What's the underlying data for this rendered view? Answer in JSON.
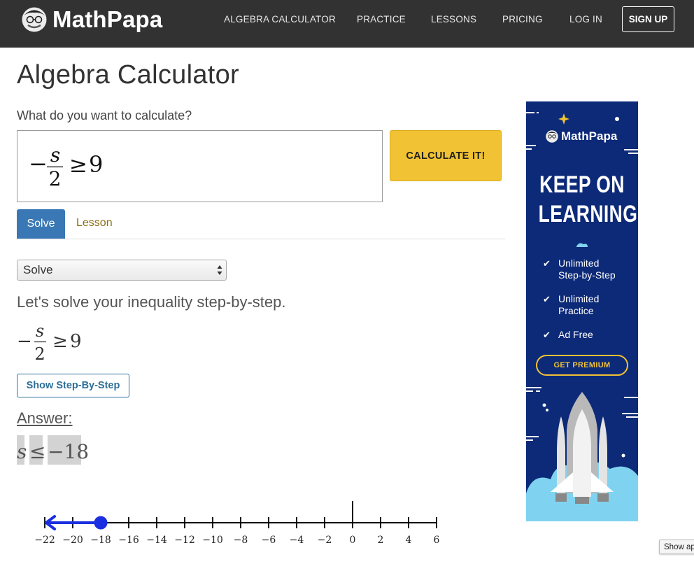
{
  "header": {
    "brand": "MathPapa",
    "nav": [
      "ALGEBRA CALCULATOR",
      "PRACTICE",
      "LESSONS",
      "PRICING",
      "LOG IN"
    ],
    "signup_label": "SIGN UP"
  },
  "page_title": "Algebra Calculator",
  "prompt": "What do you want to calculate?",
  "input": {
    "minus": "−",
    "numerator": "s",
    "denominator": "2",
    "relation": "≥",
    "rhs": "9"
  },
  "calculate_label": "CALCULATE IT!",
  "tabs": {
    "solve": "Solve",
    "lesson": "Lesson"
  },
  "select": {
    "selected": "Solve"
  },
  "intro": "Let's solve your inequality step-by-step.",
  "step_button": "Show Step-By-Step",
  "answer": {
    "label": "Answer:",
    "variable": "s",
    "relation": "≤",
    "value": "−18"
  },
  "number_line": {
    "tick_labels": [
      "−22",
      "−20",
      "−18",
      "−16",
      "−14",
      "−12",
      "−10",
      "−8",
      "−6",
      "−4",
      "−2",
      "0",
      "2",
      "4",
      "6"
    ],
    "point_value": -18,
    "direction": "left",
    "closed_point": true,
    "color": "#1a2fe0"
  },
  "ad": {
    "brand": "MathPapa",
    "headline_1": "KEEP ON",
    "headline_2": "LEARNING!",
    "features": [
      {
        "line1": "Unlimited",
        "line2": "Step-by-Step"
      },
      {
        "line1": "Unlimited",
        "line2": "Practice"
      },
      {
        "line1": "Ad Free",
        "line2": ""
      }
    ],
    "check": "✔",
    "cta": "GET PREMIUM"
  },
  "show_app": "Show ap"
}
